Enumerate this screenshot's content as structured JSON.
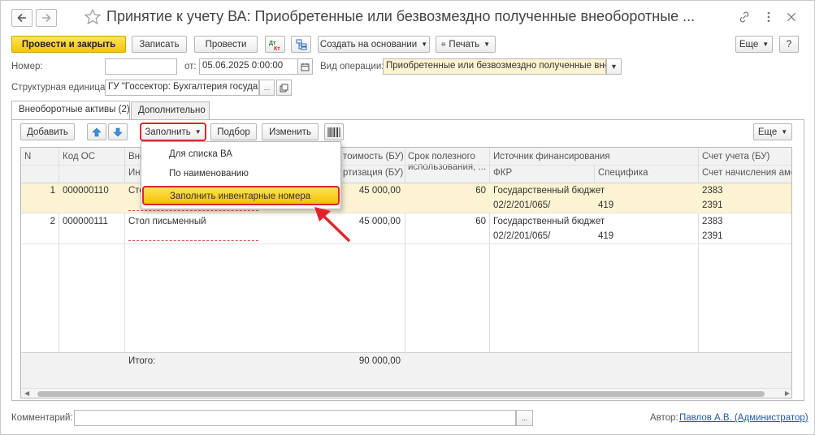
{
  "window": {
    "title": "Принятие к учету ВА: Приобретенные или безвозмездно полученные внеоборотные ..."
  },
  "toolbar": {
    "post_close": "Провести и закрыть",
    "write": "Записать",
    "post": "Провести",
    "create_based_on": "Создать на основании",
    "print": "Печать",
    "more": "Еще",
    "help": "?"
  },
  "header": {
    "number_label": "Номер:",
    "number_value": "",
    "date_label": "от:",
    "date_value": "05.06.2025  0:00:00",
    "operation_label": "Вид операции:",
    "operation_value": "Приобретенные или безвозмездно полученные внео",
    "unit_label": "Структурная единица:",
    "unit_value": "ГУ \"Госсектор: Бухгалтерия государ"
  },
  "tabs": [
    {
      "label": "Внеоборотные активы (2)"
    },
    {
      "label": "Дополнительно"
    }
  ],
  "table_toolbar": {
    "add": "Добавить",
    "fill": "Заполнить",
    "pick": "Подбор",
    "change": "Изменить",
    "more": "Еще"
  },
  "fill_menu": [
    {
      "label": "Для списка ВА"
    },
    {
      "label": "По наименованию"
    },
    {
      "label": "Заполнить инвентарные номера"
    }
  ],
  "columns": {
    "n": "N",
    "code": "Код ОС",
    "name_top": "Вне",
    "name_bottom": "Ин",
    "cost_top": "тоимость (БУ)",
    "cost_bottom": "ртизация (БУ)",
    "life": "Срок полезного использования, ...",
    "fin_source": "Источник финансирования",
    "fkr": "ФКР",
    "spec": "Специфика",
    "account": "Счет учета (БУ)",
    "amort_account": "Счет начисления амор"
  },
  "rows": [
    {
      "n": "1",
      "code": "000000110",
      "name": "Сто",
      "cost": "45 000,00",
      "life": "60",
      "fin": "Государственный бюджет",
      "fkr": "02/2/201/065/",
      "spec": "419",
      "acc": "2383",
      "amort": "2391"
    },
    {
      "n": "2",
      "code": "000000111",
      "name": "Стол письменный",
      "cost": "45 000,00",
      "life": "60",
      "fin": "Государственный бюджет",
      "fkr": "02/2/201/065/",
      "spec": "419",
      "acc": "2383",
      "amort": "2391"
    }
  ],
  "totals": {
    "label": "Итого:",
    "cost": "90 000,00"
  },
  "bottom": {
    "comment_label": "Комментарий:",
    "comment_value": "",
    "author_label": "Автор:",
    "author_value": "Павлов А.В. (Администратор)"
  },
  "colors": {
    "primary": "#f3c600",
    "selected_row": "#fbf3d2",
    "highlight_border": "#e0242b",
    "arrow": "#e0242b"
  }
}
